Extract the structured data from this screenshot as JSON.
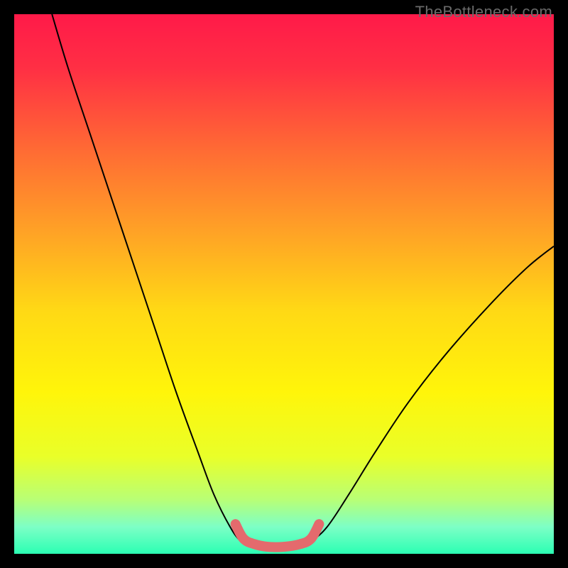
{
  "watermark": "TheBottleneck.com",
  "chart_data": {
    "type": "line",
    "title": "",
    "xlabel": "",
    "ylabel": "",
    "xlim": [
      0,
      100
    ],
    "ylim": [
      0,
      100
    ],
    "gradient_stops": [
      {
        "offset": 0,
        "color": "#ff1a49"
      },
      {
        "offset": 10,
        "color": "#ff2f44"
      },
      {
        "offset": 25,
        "color": "#ff6a34"
      },
      {
        "offset": 40,
        "color": "#ffa126"
      },
      {
        "offset": 55,
        "color": "#ffd915"
      },
      {
        "offset": 70,
        "color": "#fff50a"
      },
      {
        "offset": 82,
        "color": "#e9ff29"
      },
      {
        "offset": 90,
        "color": "#b8ff76"
      },
      {
        "offset": 95,
        "color": "#7dffc6"
      },
      {
        "offset": 100,
        "color": "#2bffb3"
      }
    ],
    "series": [
      {
        "name": "bottleneck-curve",
        "stroke": "#000000",
        "points": [
          {
            "x": 7.0,
            "y": 100.0
          },
          {
            "x": 10.0,
            "y": 90.0
          },
          {
            "x": 14.0,
            "y": 78.0
          },
          {
            "x": 18.0,
            "y": 66.0
          },
          {
            "x": 22.0,
            "y": 54.0
          },
          {
            "x": 26.0,
            "y": 42.0
          },
          {
            "x": 30.0,
            "y": 30.0
          },
          {
            "x": 34.0,
            "y": 19.0
          },
          {
            "x": 37.0,
            "y": 11.0
          },
          {
            "x": 40.0,
            "y": 5.0
          },
          {
            "x": 42.0,
            "y": 2.3
          },
          {
            "x": 44.0,
            "y": 1.3
          },
          {
            "x": 47.0,
            "y": 1.0
          },
          {
            "x": 50.0,
            "y": 1.0
          },
          {
            "x": 53.0,
            "y": 1.3
          },
          {
            "x": 55.0,
            "y": 2.3
          },
          {
            "x": 58.0,
            "y": 5.0
          },
          {
            "x": 62.0,
            "y": 11.0
          },
          {
            "x": 67.0,
            "y": 19.0
          },
          {
            "x": 73.0,
            "y": 28.0
          },
          {
            "x": 80.0,
            "y": 37.0
          },
          {
            "x": 88.0,
            "y": 46.0
          },
          {
            "x": 95.0,
            "y": 53.0
          },
          {
            "x": 100.0,
            "y": 57.0
          }
        ]
      },
      {
        "name": "optimal-range-highlight",
        "stroke": "#e46a6d",
        "stroke_width": 14,
        "points": [
          {
            "x": 41.0,
            "y": 5.5
          },
          {
            "x": 42.5,
            "y": 2.8
          },
          {
            "x": 44.5,
            "y": 1.8
          },
          {
            "x": 47.0,
            "y": 1.3
          },
          {
            "x": 50.0,
            "y": 1.3
          },
          {
            "x": 53.0,
            "y": 1.8
          },
          {
            "x": 55.0,
            "y": 2.8
          },
          {
            "x": 56.5,
            "y": 5.5
          }
        ]
      }
    ]
  }
}
